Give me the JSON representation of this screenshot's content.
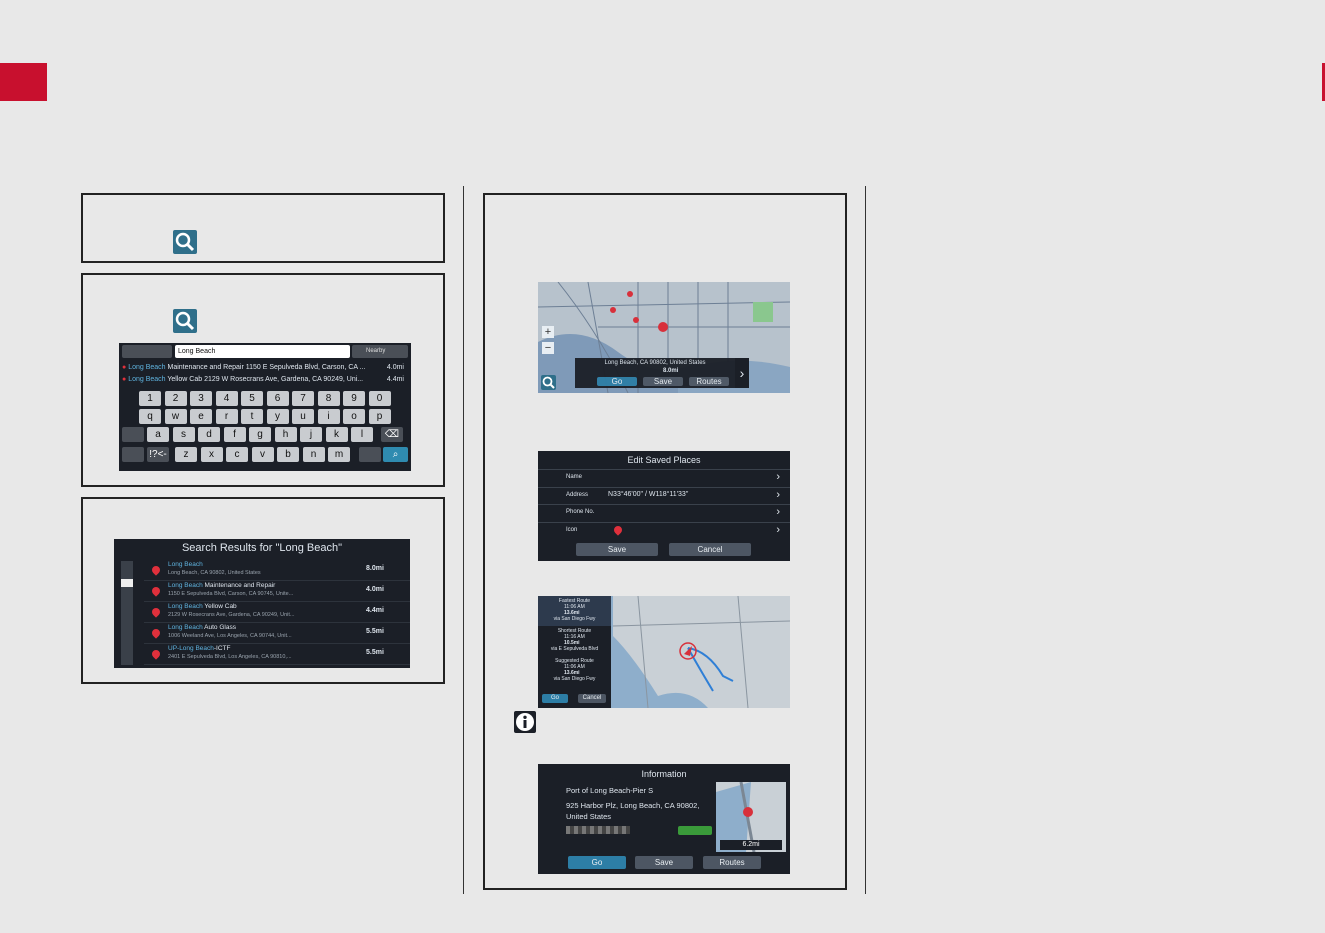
{
  "left_panel": {
    "step3": {
      "search_query": "Long Beach",
      "nearby_label": "Nearby",
      "suggestions": [
        {
          "highlight": "Long Beach",
          "text": " Maintenance and Repair 1150 E Sepulveda Blvd, Carson, CA ...",
          "dist": "4.0mi"
        },
        {
          "highlight": "Long Beach",
          "text": " Yellow Cab 2129 W Rosecrans Ave, Gardena, CA 90249, Uni...",
          "dist": "4.4mi"
        }
      ],
      "keyboard": {
        "row1": [
          "1",
          "2",
          "3",
          "4",
          "5",
          "6",
          "7",
          "8",
          "9",
          "0"
        ],
        "row2": [
          "q",
          "w",
          "e",
          "r",
          "t",
          "y",
          "u",
          "i",
          "o",
          "p"
        ],
        "row3": [
          "a",
          "s",
          "d",
          "f",
          "g",
          "h",
          "j",
          "k",
          "l"
        ],
        "row4": [
          "z",
          "x",
          "c",
          "v",
          "b",
          "n",
          "m"
        ],
        "sym_label": "!?<-"
      }
    },
    "results": {
      "title": "Search Results for \"Long Beach\"",
      "items": [
        {
          "name": "Long Beach",
          "name_rest": "",
          "sub": "Long Beach, CA 90802, United States",
          "dist": "8.0mi"
        },
        {
          "name": "Long Beach",
          "name_rest": " Maintenance and Repair",
          "sub": "1150 E Sepulveda Blvd, Carson, CA 90745, Unite...",
          "dist": "4.0mi"
        },
        {
          "name": "Long Beach",
          "name_rest": " Yellow Cab",
          "sub": "2129 W Rosecrans Ave, Gardena, CA 90249, Unit...",
          "dist": "4.4mi"
        },
        {
          "name": "Long Beach",
          "name_rest": " Auto Glass",
          "sub": "1006 Weeland Ave, Los Angeles, CA 90744, Unit...",
          "dist": "5.5mi"
        },
        {
          "name": "UP-Long Beach",
          "name_rest": "-ICTF",
          "sub": "2401 E Sepulveda Blvd, Los Angeles, CA 90810,...",
          "dist": "5.5mi"
        }
      ]
    }
  },
  "right_panel": {
    "map1": {
      "address": "Long Beach, CA 90802, United States",
      "dist": "8.0mi",
      "go": "Go",
      "save": "Save",
      "routes": "Routes"
    },
    "saved": {
      "title": "Edit Saved Places",
      "rows": [
        {
          "label": "Name",
          "value": ""
        },
        {
          "label": "Address",
          "value": "N33°46'00\" / W118°11'33\""
        },
        {
          "label": "Phone No.",
          "value": ""
        },
        {
          "label": "Icon",
          "value": ""
        }
      ],
      "save": "Save",
      "cancel": "Cancel"
    },
    "routes": {
      "items": [
        {
          "name": "Fastest Route",
          "time": "11:06 AM",
          "dist": "13.6mi",
          "via": "via San Diego Fwy"
        },
        {
          "name": "Shortest Route",
          "time": "11:16 AM",
          "dist": "10.5mi",
          "via": "via E Sepulveda Blvd"
        },
        {
          "name": "Suggested Route",
          "time": "11:06 AM",
          "dist": "13.6mi",
          "via": "via San Diego Fwy"
        }
      ],
      "go": "Go",
      "cancel": "Cancel"
    },
    "info": {
      "title": "Information",
      "place": "Port of Long Beach-Pier S",
      "address1": "925 Harbor Plz, Long Beach, CA 90802,",
      "address2": "United States",
      "dist": "6.2mi",
      "go": "Go",
      "save": "Save",
      "routes": "Routes"
    }
  }
}
